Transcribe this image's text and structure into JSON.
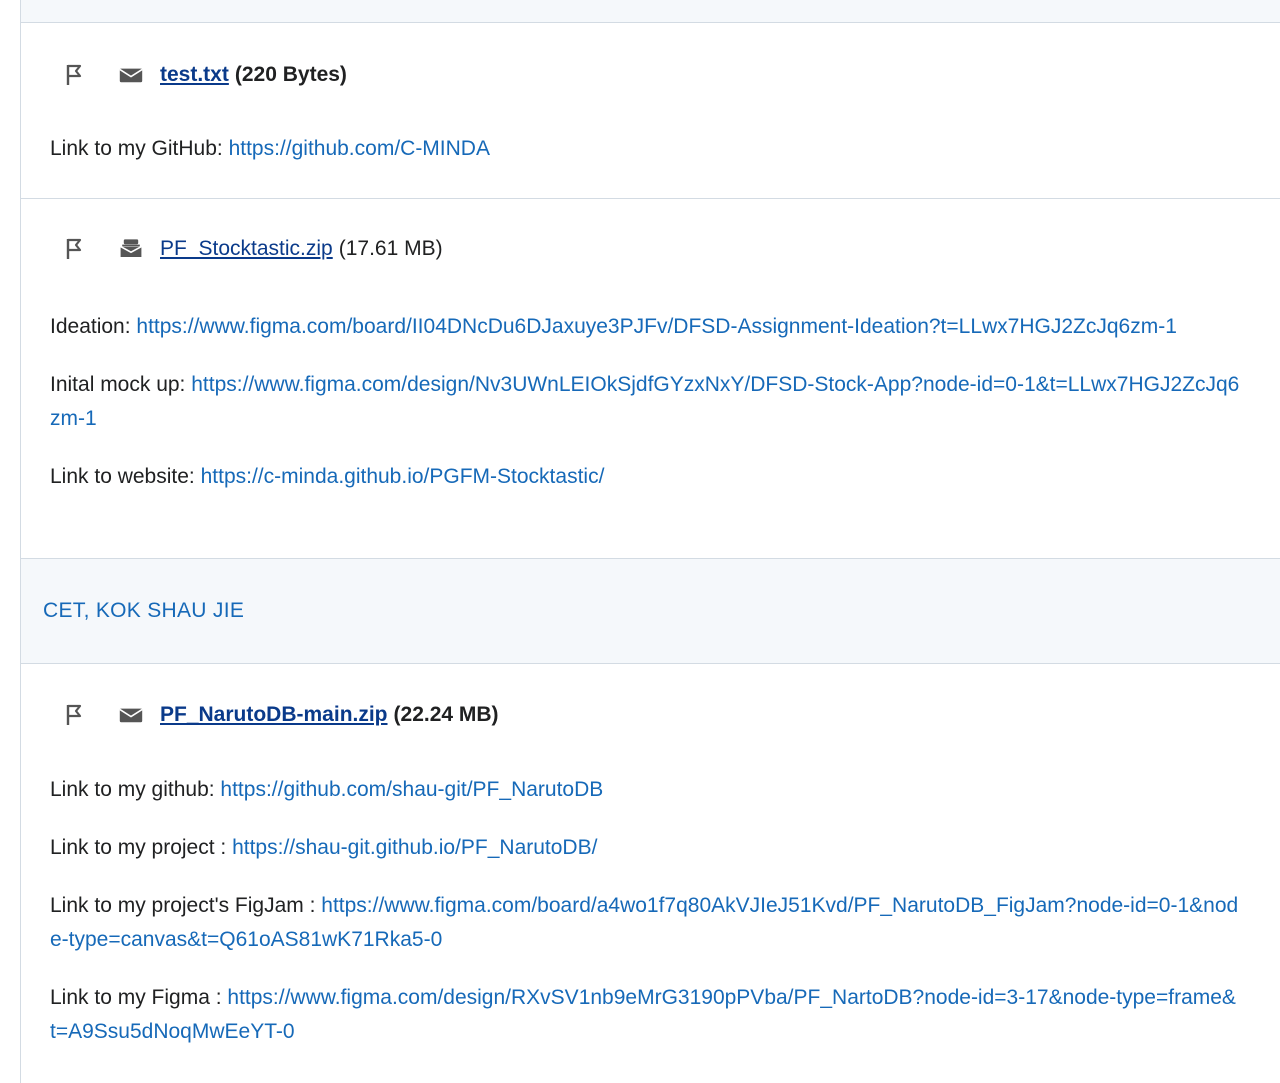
{
  "submissions": [
    {
      "file_icon": "envelope-icon",
      "file_name": "test.txt",
      "file_size": "(220 Bytes)",
      "bold": true,
      "lines": [
        {
          "label": "Link to my GitHub: ",
          "url": "https://github.com/C-MINDA"
        }
      ]
    },
    {
      "file_icon": "archive-icon",
      "file_name": "PF_Stocktastic.zip",
      "file_size": "(17.61 MB)",
      "bold": false,
      "lines": [
        {
          "label": "Ideation: ",
          "url": "https://www.figma.com/board/II04DNcDu6DJaxuye3PJFv/DFSD-Assignment-Ideation?t=LLwx7HGJ2ZcJq6zm-1"
        },
        {
          "label": "Inital mock up: ",
          "url": "https://www.figma.com/design/Nv3UWnLEIOkSjdfGYzxNxY/DFSD-Stock-App?node-id=0-1&t=LLwx7HGJ2ZcJq6zm-1"
        },
        {
          "label": "Link to website: ",
          "url": "https://c-minda.github.io/PGFM-Stocktastic/"
        }
      ]
    }
  ],
  "group": {
    "name": "CET, KOK SHAU JIE"
  },
  "submission3": {
    "file_icon": "envelope-icon",
    "file_name": "PF_NarutoDB-main.zip",
    "file_size": "(22.24 MB)",
    "lines": [
      {
        "label": "Link to my github: ",
        "url": "https://github.com/shau-git/PF_NarutoDB"
      },
      {
        "label": "Link to my project :  ",
        "url": "https://shau-git.github.io/PF_NarutoDB/"
      },
      {
        "label": "Link to my project's FigJam : ",
        "url": "https://www.figma.com/board/a4wo1f7q80AkVJIeJ51Kvd/PF_NarutoDB_FigJam?node-id=0-1&node-type=canvas&t=Q61oAS81wK71Rka5-0"
      },
      {
        "label": "Link to my Figma :  ",
        "url": "https://www.figma.com/design/RXvSV1nb9eMrG3190pPVba/PF_NartoDB?node-id=3-17&node-type=frame&t=A9Ssu5dNoqMwEeYT-0"
      }
    ]
  },
  "colors": {
    "link": "#1669b8",
    "file_link": "#0a3a8a",
    "border": "#d3dbe3",
    "header_bg": "#f5f8fb"
  }
}
